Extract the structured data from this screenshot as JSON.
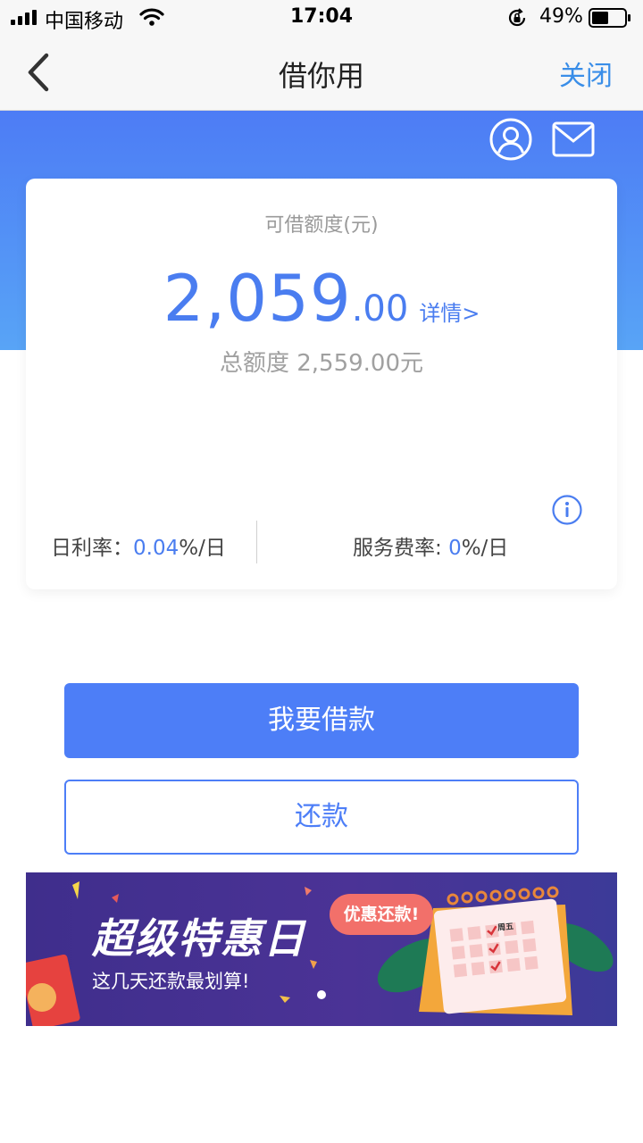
{
  "status_bar": {
    "carrier": "中国移动",
    "time": "17:04",
    "battery_percent": "49%"
  },
  "nav": {
    "title": "借你用",
    "close_label": "关闭"
  },
  "credit_card": {
    "label": "可借额度(元)",
    "amount_integer": "2,059",
    "amount_decimal": ".00",
    "detail_link": "详情>",
    "total_text": "总额度 2,559.00元",
    "daily_rate_label": "日利率：",
    "daily_rate_value": "0.04",
    "daily_rate_unit": "%/日",
    "service_rate_label": "服务费率: ",
    "service_rate_value": "0",
    "service_rate_unit": "%/日"
  },
  "actions": {
    "borrow_label": "我要借款",
    "repay_label": "还款"
  },
  "banner": {
    "title": "超级特惠日",
    "subtitle": "这几天还款最划算!",
    "badge": "优惠还款!",
    "calendar_header": "周五"
  },
  "colors": {
    "accent": "#4d7ef7",
    "nav_link": "#3a8ee8",
    "header_gradient_top": "#4d7cf5",
    "header_gradient_bottom": "#58a4f6"
  }
}
